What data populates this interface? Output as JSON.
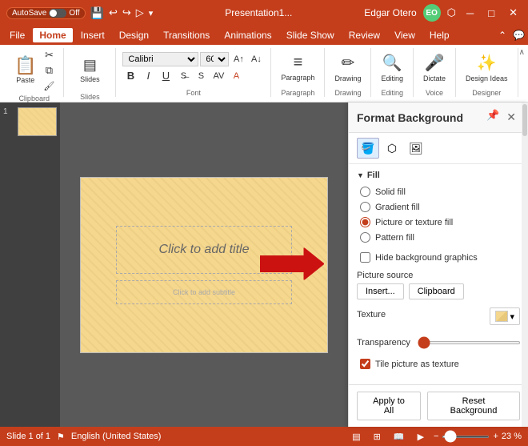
{
  "titlebar": {
    "autosave_label": "AutoSave",
    "autosave_state": "Off",
    "app_title": "Presentation1...",
    "user_name": "Edgar Otero",
    "user_initials": "EO"
  },
  "menubar": {
    "items": [
      {
        "label": "File",
        "active": false
      },
      {
        "label": "Home",
        "active": true
      },
      {
        "label": "Insert",
        "active": false
      },
      {
        "label": "Design",
        "active": false
      },
      {
        "label": "Transitions",
        "active": false
      },
      {
        "label": "Animations",
        "active": false
      },
      {
        "label": "Slide Show",
        "active": false
      },
      {
        "label": "Review",
        "active": false
      },
      {
        "label": "View",
        "active": false
      },
      {
        "label": "Help",
        "active": false
      }
    ]
  },
  "ribbon": {
    "paste_label": "Paste",
    "clipboard_label": "Clipboard",
    "slides_label": "Slides",
    "font_label": "Font",
    "paragraph_label": "Paragraph",
    "drawing_label": "Drawing",
    "editing_label": "Editing",
    "dictate_label": "Dictate",
    "design_ideas_label": "Design Ideas",
    "designer_label": "Designer",
    "voice_label": "Voice",
    "font_name": "Calibri",
    "font_size": "60"
  },
  "slide": {
    "number": "1",
    "title_placeholder": "Click to add title",
    "subtitle_placeholder": "Click to add subtitle"
  },
  "format_panel": {
    "title": "Format Background",
    "fill_section": "Fill",
    "fill_options": [
      {
        "id": "solid",
        "label": "Solid fill",
        "checked": false
      },
      {
        "id": "gradient",
        "label": "Gradient fill",
        "checked": false
      },
      {
        "id": "picture",
        "label": "Picture or texture fill",
        "checked": true
      },
      {
        "id": "pattern",
        "label": "Pattern fill",
        "checked": false
      }
    ],
    "hide_graphics_label": "Hide background graphics",
    "picture_source_label": "Picture source",
    "insert_btn": "Insert...",
    "clipboard_btn": "Clipboard",
    "texture_label": "Texture",
    "transparency_label": "Transparency",
    "transparency_value": "0 %",
    "tile_label": "Tile picture as texture",
    "apply_all_btn": "Apply to All",
    "reset_btn": "Reset Background"
  },
  "statusbar": {
    "slide_info": "Slide 1 of 1",
    "language": "English (United States)",
    "notes_label": "Notes",
    "zoom_value": "23 %"
  }
}
